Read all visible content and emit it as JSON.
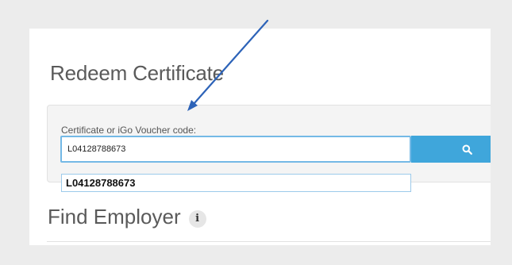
{
  "page": {
    "title": "Redeem Certificate"
  },
  "redeem": {
    "label": "Certificate or iGo Voucher code:",
    "code_value": "L04128788673",
    "search_icon": "search-icon"
  },
  "autocomplete": {
    "suggestions": [
      "L04128788673"
    ]
  },
  "employer_section": {
    "title": "Find Employer",
    "info_icon": "info-icon",
    "info_glyph": "i"
  },
  "colors": {
    "page_background": "#ececec",
    "button_accent": "#3fa6db",
    "input_focus_border": "#74b9e6",
    "annotation_arrow": "#2d63b8"
  }
}
